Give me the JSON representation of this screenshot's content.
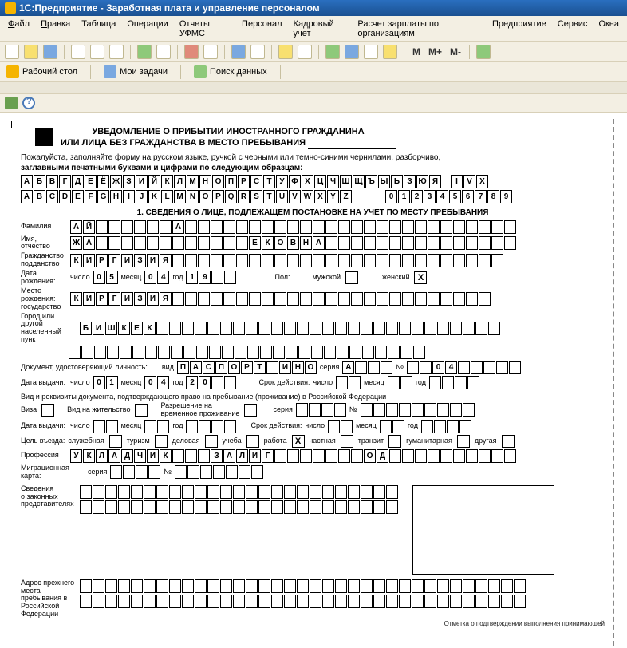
{
  "title": "1С:Предприятие - Заработная плата и управление персоналом",
  "menu": [
    "Файл",
    "Правка",
    "Таблица",
    "Операции",
    "Отчеты УФМС",
    "Персонал",
    "Кадровый учет",
    "Расчет зарплаты по организациям",
    "Предприятие",
    "Сервис",
    "Окна"
  ],
  "mbuttons": [
    "M",
    "M+",
    "M-"
  ],
  "tb2": {
    "desk": "Рабочий стол",
    "tasks": "Мои задачи",
    "search": "Поиск данных"
  },
  "doc": {
    "header1": "УВЕДОМЛЕНИЕ О ПРИБЫТИИ ИНОСТРАННОГО ГРАЖДАНИНА",
    "header2": "ИЛИ ЛИЦА БЕЗ ГРАЖДАНСТВА В МЕСТО ПРЕБЫВАНИЯ",
    "instr1": "Пожалуйста, заполняйте форму на русском языке, ручкой с черными или темно-синими чернилами, разборчиво,",
    "instr2": "заглавными печатными буквами и цифрами по следующим образцам:",
    "alpha_ru": [
      "А",
      "Б",
      "В",
      "Г",
      "Д",
      "Е",
      "Ё",
      "Ж",
      "З",
      "И",
      "Й",
      "К",
      "Л",
      "М",
      "Н",
      "О",
      "П",
      "Р",
      "С",
      "Т",
      "У",
      "Ф",
      "Х",
      "Ц",
      "Ч",
      "Ш",
      "Щ",
      "Ъ",
      "Ы",
      "Ь",
      "З",
      "Ю",
      "Я"
    ],
    "roman": [
      "I",
      "V",
      "X"
    ],
    "alpha_en": [
      "A",
      "B",
      "C",
      "D",
      "E",
      "F",
      "G",
      "H",
      "I",
      "J",
      "K",
      "L",
      "M",
      "N",
      "O",
      "P",
      "Q",
      "R",
      "S",
      "T",
      "U",
      "V",
      "W",
      "X",
      "Y",
      "Z"
    ],
    "digits": [
      "0",
      "1",
      "2",
      "3",
      "4",
      "5",
      "6",
      "7",
      "8",
      "9"
    ],
    "section1": "1. СВЕДЕНИЯ О ЛИЦЕ, ПОДЛЕЖАЩЕМ ПОСТАНОВКЕ НА УЧЕТ ПО МЕСТУ ПРЕБЫВАНИЯ",
    "labels": {
      "surname": "Фамилия",
      "name": "Имя,\nотчество",
      "citizenship": "Гражданство\nподданство",
      "birthdate": "Дата\nрождения:",
      "num": "число",
      "mon": "месяц",
      "yr": "год",
      "sex": "Пол:",
      "male": "мужской",
      "female": "женский",
      "birthplace": "Место рождения:\nгосударство",
      "city": "Город или другой\nнаселенный пункт",
      "iddoc": "Документ, удостоверяющий личность:",
      "kind": "вид",
      "series": "серия",
      "no": "№",
      "issuedate": "Дата выдачи:",
      "valid": "Срок действия:",
      "residencydoc": "Вид и реквизиты документа, подтверждающего право на пребывание (проживание) в Российской Федерации",
      "visa": "Виза",
      "residence": "Вид на жительство",
      "temp": "Разрешение на\nвременное проживание",
      "purpose": "Цель въезда:",
      "p_service": "служебная",
      "p_tour": "туризм",
      "p_biz": "деловая",
      "p_study": "учеба",
      "p_work": "работа",
      "p_priv": "частная",
      "p_trans": "транзит",
      "p_hum": "гуманитарная",
      "p_other": "другая",
      "profession": "Профессия",
      "migcard": "Миграционная карта:",
      "repinfo": "Сведения\nо законных\nпредставителях",
      "prevaddr": "Адрес прежнего\nместа\nпребывания в\nРоссийской\nФедерации"
    },
    "values": {
      "surname": [
        "А",
        "Й",
        "",
        "",
        "",
        "",
        "",
        "",
        "А"
      ],
      "name": [
        "Ж",
        "А",
        "",
        "",
        "",
        "",
        "",
        "",
        "",
        "",
        "",
        "",
        "",
        "",
        "Е",
        "К",
        "О",
        "В",
        "Н",
        "А"
      ],
      "citizenship": [
        "К",
        "И",
        "Р",
        "Г",
        "И",
        "З",
        "И",
        "Я"
      ],
      "birth_d": [
        "0",
        "5"
      ],
      "birth_m": [
        "0",
        "4"
      ],
      "birth_y": [
        "1",
        "9",
        "",
        ""
      ],
      "female_mark": "X",
      "birthplace": [
        "К",
        "И",
        "Р",
        "Г",
        "И",
        "З",
        "И",
        "Я"
      ],
      "city": [
        "Б",
        "И",
        "Ш",
        "К",
        "Е",
        "К"
      ],
      "doc_kind": [
        "П",
        "А",
        "С",
        "П",
        "О",
        "Р",
        "Т",
        " ",
        "И",
        "Н",
        "О"
      ],
      "doc_series": [
        "А",
        ""
      ],
      "doc_no": [
        "",
        "",
        "0",
        "4",
        ""
      ],
      "issue_d": [
        "0",
        "1"
      ],
      "issue_m": [
        "0",
        "4"
      ],
      "issue_y": [
        "2",
        "0",
        "",
        ""
      ],
      "purpose_mark": "X",
      "profession": [
        "У",
        "К",
        "Л",
        "А",
        "Д",
        "Ч",
        "И",
        "К",
        "",
        "–",
        "",
        "З",
        "А",
        "Л",
        "И",
        "Г",
        "",
        "",
        "",
        "",
        "",
        "",
        "",
        "О",
        "Д"
      ]
    },
    "footnote": "Отметка о подтверждении выполнения принимающей"
  }
}
